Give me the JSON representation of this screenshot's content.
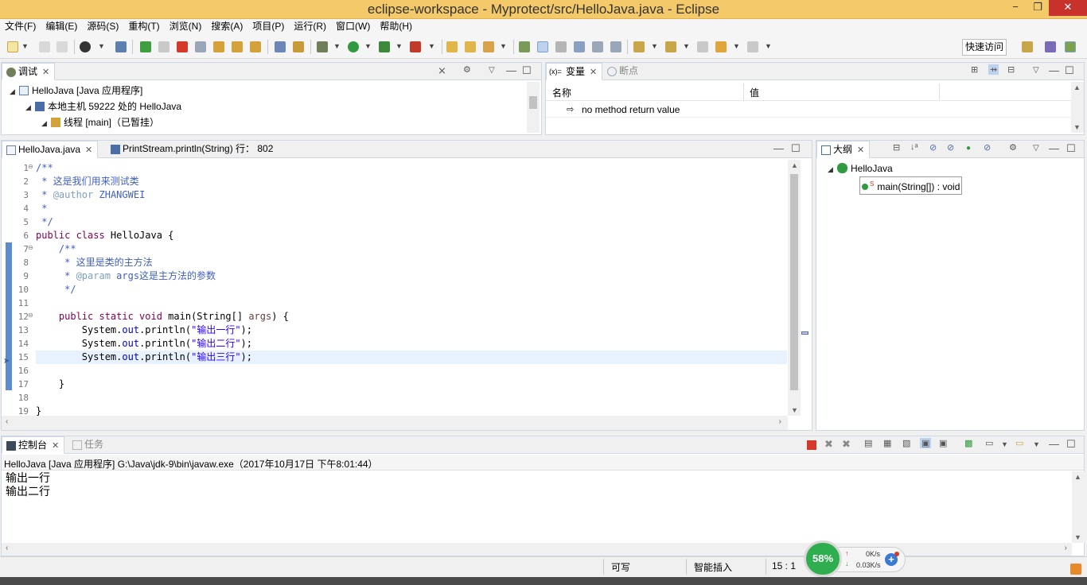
{
  "window": {
    "title": "eclipse-workspace - Myprotect/src/HelloJava.java - Eclipse",
    "minimize": "−",
    "maximize": "❐",
    "close": "✕"
  },
  "menu": [
    "文件(F)",
    "编辑(E)",
    "源码(S)",
    "重构(T)",
    "浏览(N)",
    "搜索(A)",
    "项目(P)",
    "运行(R)",
    "窗口(W)",
    "帮助(H)"
  ],
  "quick_access": "快速访问",
  "debug_view": {
    "tab": "调试",
    "tree": [
      {
        "label": "HelloJava [Java 应用程序]"
      },
      {
        "label": "本地主机 59222 处的 HelloJava"
      },
      {
        "label": "线程 [main]（已暂挂）"
      }
    ]
  },
  "variables_view": {
    "tabs": [
      "变量",
      "断点"
    ],
    "columns": [
      "名称",
      "值"
    ],
    "rows": [
      {
        "name": "no method return value",
        "value": ""
      }
    ]
  },
  "editor": {
    "tabs": [
      {
        "label": "HelloJava.java"
      },
      {
        "label": "PrintStream.println(String) 行： 802"
      }
    ],
    "lines": [
      {
        "n": "1",
        "fold": "⊖",
        "parts": [
          {
            "t": "/**",
            "c": "cm"
          }
        ]
      },
      {
        "n": "2",
        "parts": [
          {
            "t": " * 这是我们用来测试类",
            "c": "cm"
          }
        ]
      },
      {
        "n": "3",
        "parts": [
          {
            "t": " * ",
            "c": "cm"
          },
          {
            "t": "@author",
            "c": "tag"
          },
          {
            "t": " ZHANGWEI",
            "c": "cm"
          }
        ]
      },
      {
        "n": "4",
        "parts": [
          {
            "t": " *",
            "c": "cm"
          }
        ]
      },
      {
        "n": "5",
        "parts": [
          {
            "t": " */",
            "c": "cm"
          }
        ]
      },
      {
        "n": "6",
        "parts": [
          {
            "t": "public class",
            "c": "kw"
          },
          {
            "t": " HelloJava {",
            "c": ""
          }
        ]
      },
      {
        "n": "7",
        "fold": "⊖",
        "parts": [
          {
            "t": "    /**",
            "c": "cm"
          }
        ]
      },
      {
        "n": "8",
        "parts": [
          {
            "t": "     * 这里是类的主方法",
            "c": "cm"
          }
        ]
      },
      {
        "n": "9",
        "parts": [
          {
            "t": "     * ",
            "c": "cm"
          },
          {
            "t": "@param",
            "c": "tag"
          },
          {
            "t": " args这是主方法的参数",
            "c": "cm"
          }
        ]
      },
      {
        "n": "10",
        "parts": [
          {
            "t": "     */",
            "c": "cm"
          }
        ]
      },
      {
        "n": "11",
        "parts": []
      },
      {
        "n": "12",
        "fold": "⊖",
        "parts": [
          {
            "t": "    public static void",
            "c": "kw"
          },
          {
            "t": " main(String[] ",
            "c": ""
          },
          {
            "t": "args",
            "c": "par"
          },
          {
            "t": ") {",
            "c": ""
          }
        ]
      },
      {
        "n": "13",
        "parts": [
          {
            "t": "        System.",
            "c": ""
          },
          {
            "t": "out",
            "c": "fld"
          },
          {
            "t": ".println(",
            "c": ""
          },
          {
            "t": "\"输出一行\"",
            "c": "st"
          },
          {
            "t": ");",
            "c": ""
          }
        ]
      },
      {
        "n": "14",
        "parts": [
          {
            "t": "        System.",
            "c": ""
          },
          {
            "t": "out",
            "c": "fld"
          },
          {
            "t": ".println(",
            "c": ""
          },
          {
            "t": "\"输出二行\"",
            "c": "st"
          },
          {
            "t": ");",
            "c": ""
          }
        ]
      },
      {
        "n": "15",
        "parts": [
          {
            "t": "        System.",
            "c": ""
          },
          {
            "t": "out",
            "c": "fld"
          },
          {
            "t": ".println(",
            "c": ""
          },
          {
            "t": "\"输出三行\"",
            "c": "st"
          },
          {
            "t": ");",
            "c": ""
          }
        ]
      },
      {
        "n": "16",
        "parts": []
      },
      {
        "n": "17",
        "parts": [
          {
            "t": "    }",
            "c": ""
          }
        ]
      },
      {
        "n": "18",
        "parts": []
      },
      {
        "n": "19",
        "parts": [
          {
            "t": "}",
            "c": ""
          }
        ]
      }
    ]
  },
  "outline_view": {
    "tab": "大纲",
    "class": "HelloJava",
    "method_modifier": "S",
    "method": "main(String[]) : void"
  },
  "console_view": {
    "tabs": [
      "控制台",
      "任务"
    ],
    "header": "HelloJava [Java 应用程序] G:\\Java\\jdk-9\\bin\\javaw.exe（2017年10月17日 下午8:01:44）",
    "output": [
      "输出一行",
      "输出二行"
    ]
  },
  "status_bar": {
    "writable": "可写",
    "insert_mode": "智能插入",
    "position": "15 : 1"
  },
  "net_widget": {
    "percent": "58%",
    "up": "0K/s",
    "down": "0.03K/s"
  },
  "colors": {
    "titlebar": "#f3c96a",
    "close": "#c7322c",
    "current_line": "#e8f2fe"
  }
}
